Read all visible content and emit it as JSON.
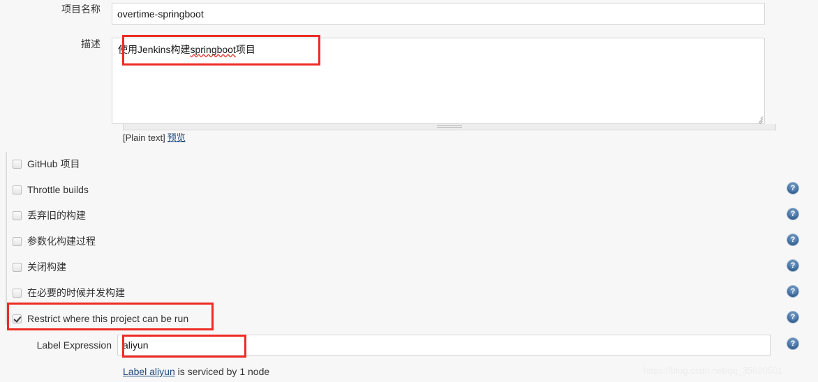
{
  "form": {
    "project_name": {
      "label": "项目名称",
      "value": "overtime-springboot",
      "placeholder": ""
    },
    "description": {
      "label": "描述",
      "value_prefix": "使用Jenkins构建",
      "value_misspelled": "springboot",
      "value_suffix": "项目",
      "full_value": "使用Jenkins构建springboot项目",
      "placeholder": "",
      "markup_note": "[Plain text]",
      "preview_link": "预览"
    }
  },
  "options": {
    "items": [
      {
        "label": "GitHub 项目",
        "checked": false,
        "help": false
      },
      {
        "label": "Throttle builds",
        "checked": false,
        "help": true
      },
      {
        "label": "丢弃旧的构建",
        "checked": false,
        "help": true
      },
      {
        "label": "参数化构建过程",
        "checked": false,
        "help": true
      },
      {
        "label": "关闭构建",
        "checked": false,
        "help": true
      },
      {
        "label": "在必要的时候并发构建",
        "checked": false,
        "help": true
      },
      {
        "label": "Restrict where this project can be run",
        "checked": true,
        "help": true
      }
    ],
    "help_icon_name": "help-icon"
  },
  "label_expression": {
    "label": "Label Expression",
    "value": "aliyun",
    "placeholder": "",
    "status_link": "Label aliyun",
    "status_rest": " is serviced by 1 node",
    "help": true
  },
  "annotations": {
    "color": "#ee2b24",
    "boxes": [
      "description-field",
      "restrict-where-checkbox",
      "label-expression-field"
    ]
  },
  "watermark": {
    "text": "https://blog.csdn.net/qq_35620501"
  },
  "colors": {
    "background": "#f7f7f7",
    "input_background": "#ffffff",
    "input_border": "#d4d4d4",
    "link": "#1c4a7e",
    "annotation_red": "#ee2b24",
    "help_blue": "#4f7dae",
    "watermark": "#ededed"
  }
}
